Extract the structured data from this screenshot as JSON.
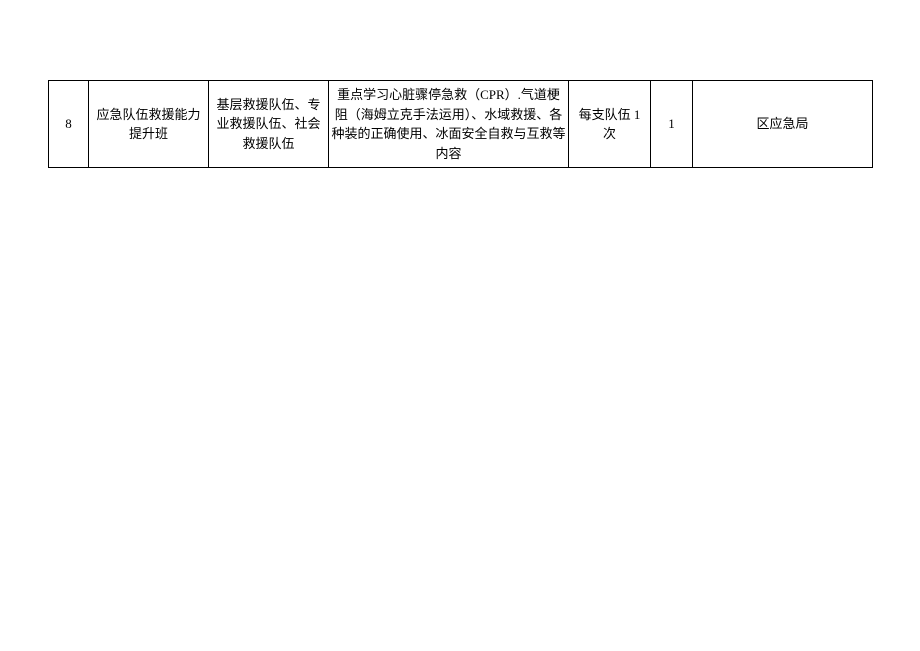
{
  "table": {
    "rows": [
      {
        "index": "8",
        "name": "应急队伍救援能力提升班",
        "target": "基层救援队伍、专业救援队伍、社会救援队伍",
        "content": "重点学习心脏骤停急救（CPR）.气道梗阻（海姆立克手法运用）、水域救援、各种装的正确使用、冰面安全自救与互救等内容",
        "times": "每支队伍 1 次",
        "note": "1",
        "dept": "区应急局"
      }
    ]
  }
}
